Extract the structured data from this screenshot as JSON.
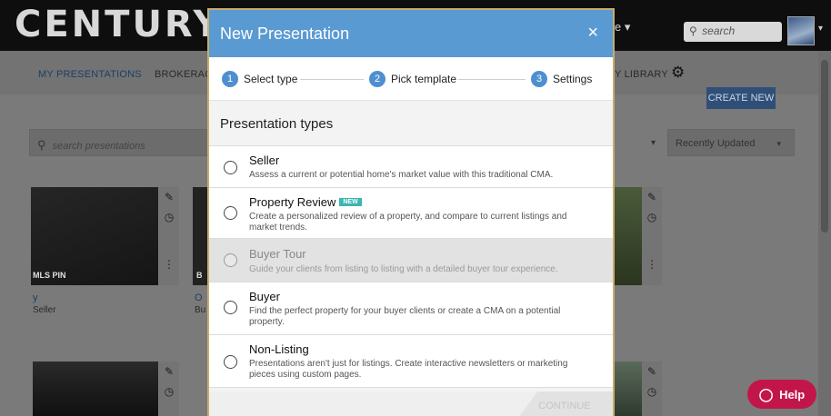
{
  "app": {
    "logo": "CENTURY",
    "top_menu_label": "e",
    "top_menu_caret": "▾",
    "top_search": {
      "icon": "search-icon",
      "placeholder": "search"
    },
    "avatar_caret": "▾"
  },
  "nav": {
    "my_presentations": "MY PRESENTATIONS",
    "brokerage": "BROKERAG",
    "library": "Y LIBRARY",
    "gear_icon": "gear-icon",
    "create_new": "CREATE NEW"
  },
  "filters": {
    "search_placeholder": "search presentations",
    "sort_value": "Recently Updated",
    "caret": "▾"
  },
  "cards": [
    {
      "thumb_label": "MLS PIN",
      "title": "y",
      "subtitle": "Seller"
    },
    {
      "thumb_label": "B",
      "title": "O",
      "subtitle": "Bu"
    }
  ],
  "card_icons": {
    "edit": "✎",
    "history": "◷",
    "more": "⋮"
  },
  "help": {
    "label": "Help",
    "icon": "chat-bubble-icon"
  },
  "modal": {
    "title": "New Presentation",
    "close": "×",
    "steps": [
      {
        "num": "1",
        "label": "Select type"
      },
      {
        "num": "2",
        "label": "Pick template"
      },
      {
        "num": "3",
        "label": "Settings"
      }
    ],
    "types_heading": "Presentation types",
    "options": [
      {
        "name": "Seller",
        "desc": "Assess a current or potential home's market value with this traditional CMA.",
        "badge": "",
        "disabled": false
      },
      {
        "name": "Property Review",
        "desc": "Create a personalized review of a property, and compare to current listings and market trends.",
        "badge": "NEW",
        "disabled": false
      },
      {
        "name": "Buyer Tour",
        "desc": "Guide your clients from listing to listing with a detailed buyer tour experience.",
        "badge": "",
        "disabled": true
      },
      {
        "name": "Buyer",
        "desc": "Find the perfect property for your buyer clients or create a CMA on a potential property.",
        "badge": "",
        "disabled": false
      },
      {
        "name": "Non-Listing",
        "desc": "Presentations aren't just for listings. Create interactive newsletters or marketing pieces using custom pages.",
        "badge": "",
        "disabled": false
      }
    ],
    "continue_label": "CONTINUE",
    "colors": {
      "header": "#5a9ad2",
      "step": "#4f8fd0",
      "badge": "#3cb6b0",
      "help": "#c2164a"
    }
  }
}
